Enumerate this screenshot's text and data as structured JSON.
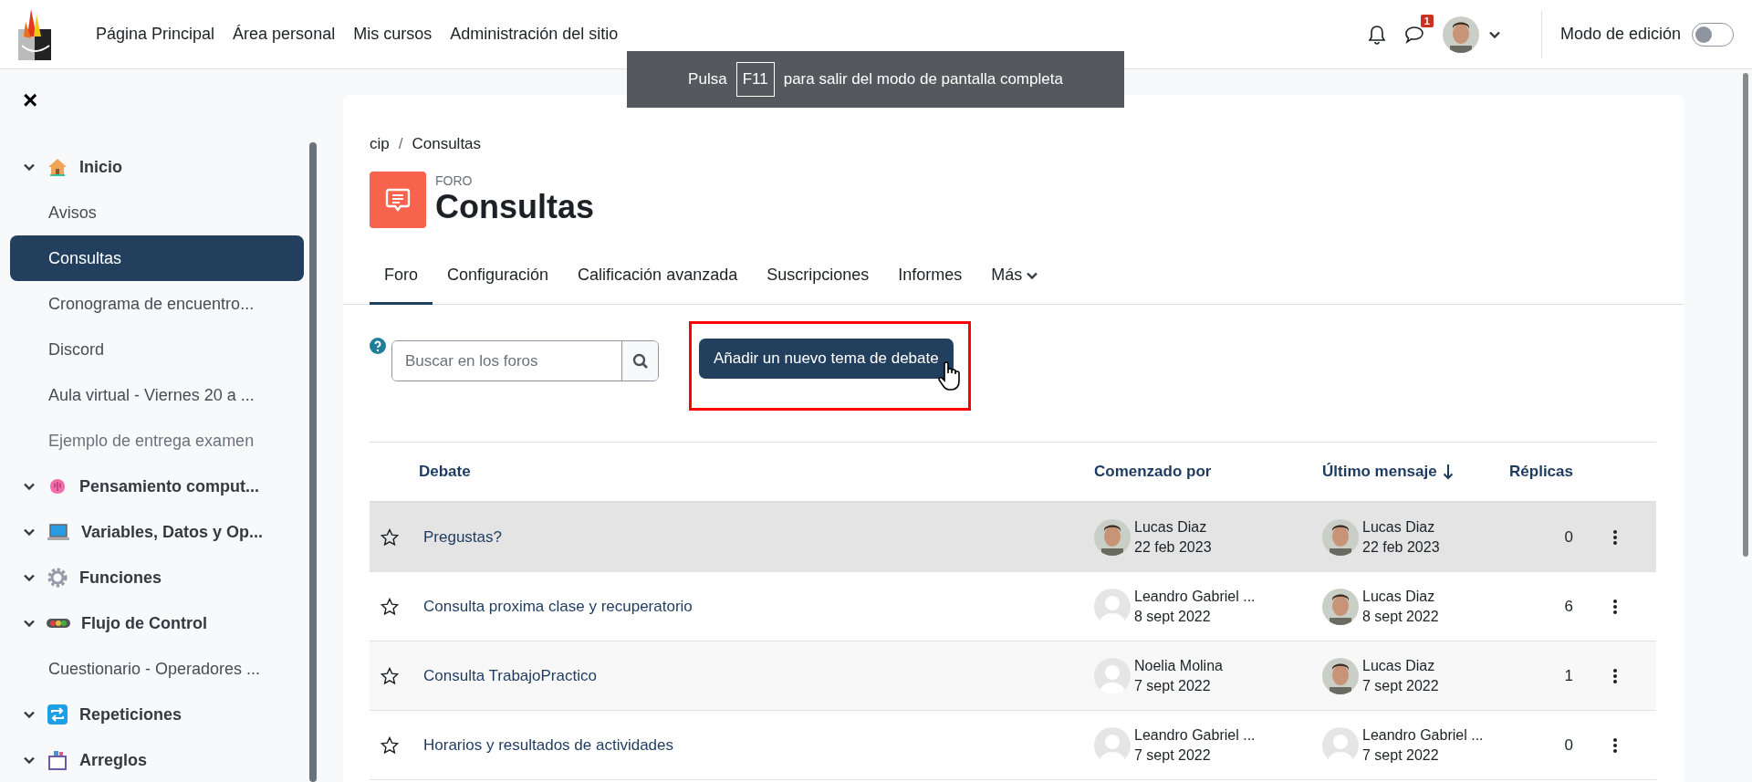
{
  "nav": {
    "links": [
      "Página Principal",
      "Área personal",
      "Mis cursos",
      "Administración del sitio"
    ],
    "message_badge": "1",
    "edit_mode": {
      "label": "Modo de edición",
      "on": false
    }
  },
  "fullscreen_notice": {
    "before": "Pulsa",
    "key": "F11",
    "after": "para salir del modo de pantalla completa"
  },
  "sidebar": {
    "close": "×",
    "items": [
      {
        "kind": "section",
        "label": "Inicio",
        "expanded": true
      },
      {
        "kind": "link",
        "label": "Avisos",
        "selected": false,
        "dimmed": false
      },
      {
        "kind": "link",
        "label": "Consultas",
        "selected": true,
        "dimmed": false
      },
      {
        "kind": "link",
        "label": "Cronograma de encuentro...",
        "selected": false,
        "dimmed": false
      },
      {
        "kind": "link",
        "label": "Discord",
        "selected": false,
        "dimmed": false
      },
      {
        "kind": "link",
        "label": "Aula virtual - Viernes 20 a ...",
        "selected": false,
        "dimmed": false
      },
      {
        "kind": "link",
        "label": "Ejemplo de entrega examen",
        "selected": false,
        "dimmed": true
      },
      {
        "kind": "section",
        "label": "Pensamiento comput...",
        "expanded": true
      },
      {
        "kind": "section",
        "label": "Variables, Datos y Op...",
        "expanded": true
      },
      {
        "kind": "section",
        "label": "Funciones",
        "expanded": true
      },
      {
        "kind": "section",
        "label": "Flujo de Control",
        "expanded": true
      },
      {
        "kind": "link",
        "label": "Cuestionario - Operadores ...",
        "selected": false,
        "dimmed": false
      },
      {
        "kind": "section",
        "label": "Repeticiones",
        "expanded": true
      },
      {
        "kind": "section",
        "label": "Arreglos",
        "expanded": true
      }
    ]
  },
  "breadcrumb": {
    "separator": "/",
    "items": [
      "cip",
      "Consultas"
    ]
  },
  "page": {
    "type_label": "FORO",
    "title": "Consultas"
  },
  "tabs": [
    {
      "label": "Foro",
      "selected": true
    },
    {
      "label": "Configuración",
      "selected": false
    },
    {
      "label": "Calificación avanzada",
      "selected": false
    },
    {
      "label": "Suscripciones",
      "selected": false
    },
    {
      "label": "Informes",
      "selected": false
    },
    {
      "label": "Más",
      "selected": false,
      "dropdown": true
    }
  ],
  "search": {
    "placeholder": "Buscar en los foros"
  },
  "add_button": {
    "label": "Añadir un nuevo tema de debate",
    "highlighted": true
  },
  "table": {
    "columns": [
      {
        "label": "Debate",
        "sorted": false
      },
      {
        "label": "Comenzado por",
        "sorted": false
      },
      {
        "label": "Último mensaje",
        "sorted": true
      },
      {
        "label": "Réplicas",
        "sorted": false
      }
    ],
    "rows": [
      {
        "title": "Pregustas?",
        "starred": false,
        "hovered": true,
        "started_by": {
          "name": "Lucas Diaz",
          "date": "22 feb 2023",
          "has_photo": true
        },
        "last_post": {
          "name": "Lucas Diaz",
          "date": "22 feb 2023",
          "has_photo": true
        },
        "replies": "0"
      },
      {
        "title": "Consulta proxima clase y recuperatorio",
        "starred": false,
        "hovered": false,
        "started_by": {
          "name": "Leandro Gabriel ...",
          "date": "8 sept 2022",
          "has_photo": false
        },
        "last_post": {
          "name": "Lucas Diaz",
          "date": "8 sept 2022",
          "has_photo": true
        },
        "replies": "6"
      },
      {
        "title": "Consulta TrabajoPractico",
        "starred": false,
        "hovered": false,
        "started_by": {
          "name": "Noelia Molina",
          "date": "7 sept 2022",
          "has_photo": false
        },
        "last_post": {
          "name": "Lucas Diaz",
          "date": "7 sept 2022",
          "has_photo": true
        },
        "replies": "1"
      },
      {
        "title": "Horarios y resultados de actividades",
        "starred": false,
        "hovered": false,
        "started_by": {
          "name": "Leandro Gabriel ...",
          "date": "7 sept 2022",
          "has_photo": false
        },
        "last_post": {
          "name": "Leandro Gabriel ...",
          "date": "7 sept 2022",
          "has_photo": false
        },
        "replies": "0"
      }
    ]
  }
}
